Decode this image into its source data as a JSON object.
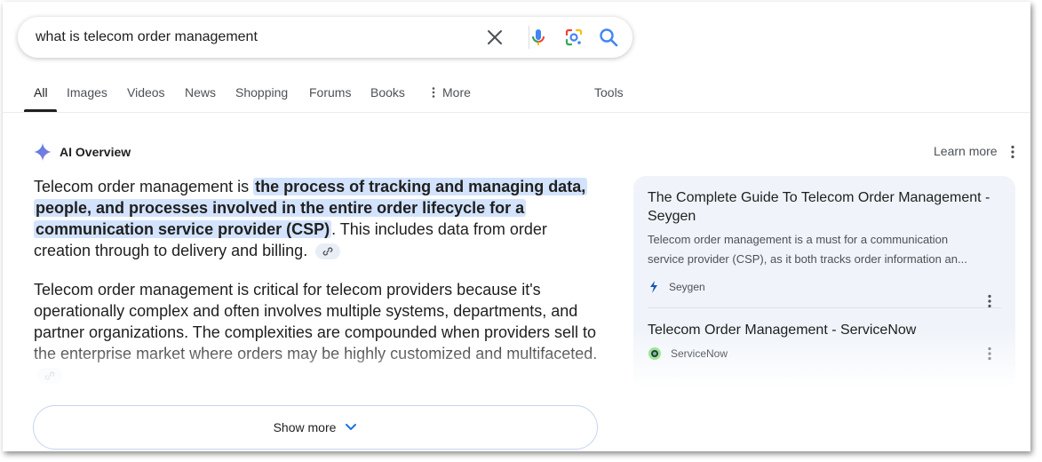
{
  "search": {
    "query": "what is telecom order management"
  },
  "tabs": [
    {
      "label": "All"
    },
    {
      "label": "Images"
    },
    {
      "label": "Videos"
    },
    {
      "label": "News"
    },
    {
      "label": "Shopping"
    },
    {
      "label": "Forums"
    },
    {
      "label": "Books"
    },
    {
      "label": "More"
    }
  ],
  "tools_label": "Tools",
  "ai_overview": {
    "title": "AI Overview",
    "learn_more": "Learn more",
    "p1_prefix": "Telecom order management is ",
    "p1_highlight": "the process of tracking and managing data, people, and processes involved in the entire order lifecycle for a communication service provider (CSP)",
    "p1_suffix": ". This includes data from order creation through to delivery and billing.",
    "p2": "Telecom order management is critical for telecom providers because it's operationally complex and often involves multiple systems, departments, and partner organizations. The complexities are compounded when providers sell to the enterprise market where orders may be highly customized and multifaceted.",
    "show_more": "Show more"
  },
  "sources": [
    {
      "title": "The Complete Guide To Telecom Order Management - Seygen",
      "snippet_line1": "Telecom order management is a must for a communication",
      "snippet_line2": "service provider (CSP), as it both tracks order information an...",
      "site": "Seygen"
    },
    {
      "title": "Telecom Order Management - ServiceNow",
      "site": "ServiceNow"
    }
  ],
  "colors": {
    "highlight": "#d3e3fd",
    "accent_blue": "#1a73e8",
    "card_bg": "#f0f4fa"
  }
}
